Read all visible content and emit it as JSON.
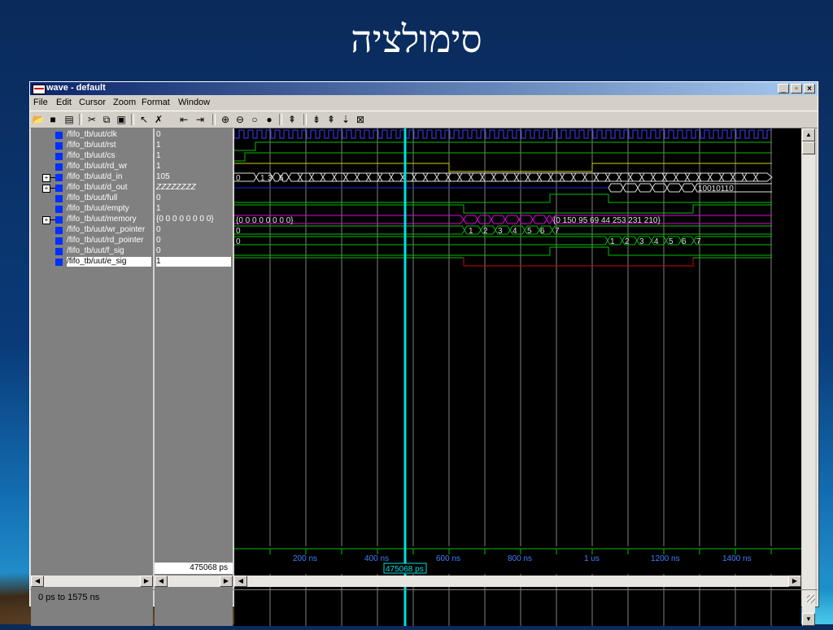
{
  "slide": {
    "title": "סימולציה"
  },
  "window": {
    "title": "wave - default",
    "buttons": [
      "_",
      "▫",
      "×"
    ]
  },
  "menu": [
    "File",
    "Edit",
    "Cursor",
    "Zoom",
    "Format",
    "Window"
  ],
  "toolbar": [
    "open-icon",
    "save-icon",
    "print-icon",
    "cut-icon",
    "copy-icon",
    "paste-icon",
    "select-icon",
    "delete-icon",
    "cursor-left-icon",
    "cursor-right-icon",
    "zoom-in-icon",
    "zoom-out-icon",
    "zoom-full-icon",
    "zoom-range-icon",
    "insert-icon",
    "edge-prev-icon",
    "edge-next-icon",
    "find-icon",
    "break-icon"
  ],
  "signals": [
    {
      "name": "/fifo_tb/uut/clk",
      "value": "0"
    },
    {
      "name": "/fifo_tb/uut/rst",
      "value": "1"
    },
    {
      "name": "/fifo_tb/uut/cs",
      "value": "1"
    },
    {
      "name": "/fifo_tb/uut/rd_wr",
      "value": "1"
    },
    {
      "name": "/fifo_tb/uut/d_in",
      "value": "105",
      "expandable": true
    },
    {
      "name": "/fifo_tb/uut/d_out",
      "value": "ZZZZZZZZ",
      "expandable": true
    },
    {
      "name": "/fifo_tb/uut/full",
      "value": "0"
    },
    {
      "name": "/fifo_tb/uut/empty",
      "value": "1"
    },
    {
      "name": "/fifo_tb/uut/memory",
      "value": "{0 0 0 0 0 0 0 0}",
      "expandable": true
    },
    {
      "name": "/fifo_tb/uut/wr_pointer",
      "value": "0"
    },
    {
      "name": "/fifo_tb/uut/rd_pointer",
      "value": "0"
    },
    {
      "name": "/fifo_tb/uut/f_sig",
      "value": "0"
    },
    {
      "name": "/fifo_tb/uut/e_sig",
      "value": "1",
      "selected": true
    }
  ],
  "waveform_labels": {
    "d_in_first": "0",
    "d_in_a": "1",
    "d_in_b": "3",
    "d_in_c": "6",
    "d_out_final": "10010110",
    "memory_initial": "{0 0 0 0 0 0 0 0}",
    "memory_final": "{0 150 95 69 44 253 231 210}",
    "wr_pointer_initial": "0",
    "wr_pointer_steps": [
      "1",
      "2",
      "3",
      "4",
      "5",
      "6",
      "7"
    ],
    "rd_pointer_initial": "0",
    "rd_pointer_steps": [
      "1",
      "2",
      "3",
      "4",
      "5",
      "6",
      "7"
    ]
  },
  "time_axis": {
    "ticks": [
      "200 ns",
      "400 ns",
      "600 ns",
      "800 ns",
      "1 us",
      "1200 ns",
      "1400 ns"
    ],
    "cursor_label": "475068 ps"
  },
  "cursor_readout": "475068 ps",
  "status": {
    "range": "0 ps to 1575 ns"
  },
  "colors": {
    "clk": "#4040ff",
    "signal": "#00c000",
    "yellow": "#d0d000",
    "bus": "#e0e0e0",
    "magenta": "#e000e0",
    "cursor": "#00e0e0",
    "red": "#d00000",
    "blue": "#2020ff"
  }
}
